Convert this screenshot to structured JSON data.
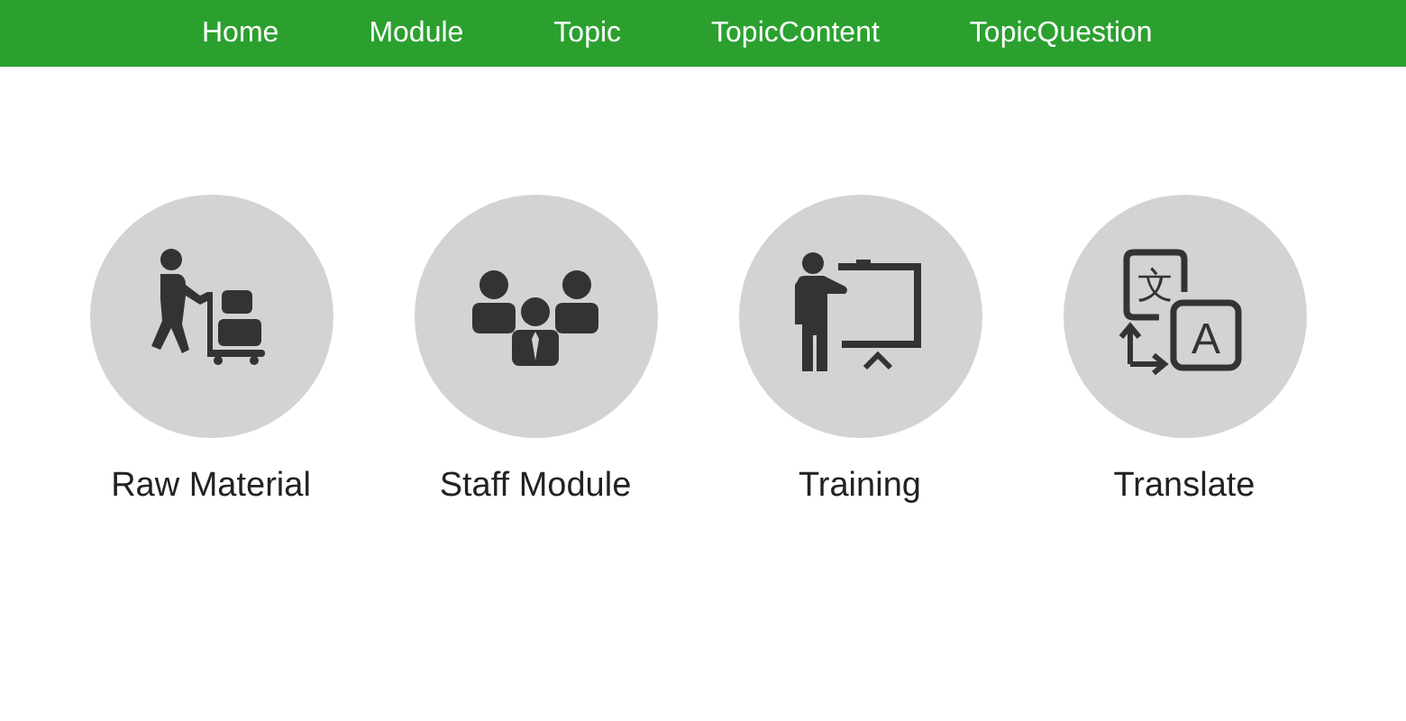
{
  "nav": [
    {
      "label": "Home"
    },
    {
      "label": "Module"
    },
    {
      "label": "Topic"
    },
    {
      "label": "TopicContent"
    },
    {
      "label": "TopicQuestion"
    }
  ],
  "tiles": [
    {
      "kind": "worker",
      "label": "Raw Material"
    },
    {
      "kind": "team",
      "label": "Staff Module"
    },
    {
      "kind": "presenter",
      "label": "Training"
    },
    {
      "kind": "translate",
      "label": "Translate",
      "icon_text": [
        "文",
        "A"
      ]
    }
  ]
}
